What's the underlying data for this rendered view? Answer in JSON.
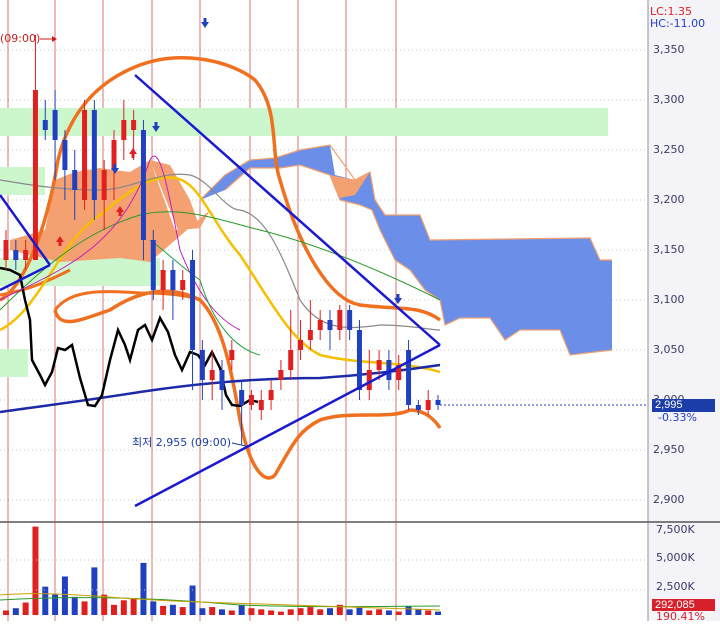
{
  "chart_data": [
    {
      "type": "candlestick",
      "title": "",
      "price_axis": {
        "ticks": [
          "3,350",
          "3,300",
          "3,250",
          "3,200",
          "3,150",
          "3,100",
          "3,050",
          "3,000",
          "2,950",
          "2,900"
        ],
        "ylim": [
          2880,
          3380
        ]
      },
      "header": {
        "lc": "LC:1.35",
        "hc": "HC:-11.00"
      },
      "current": {
        "price": "2,995",
        "change_pct": "-0.33%"
      },
      "annotations": {
        "low_label": "최저 2,955 (09:00)",
        "top_time": "(09:00)"
      },
      "candles": [
        {
          "o": 3140,
          "c": 3160,
          "h": 3170,
          "l": 3130,
          "up": true
        },
        {
          "o": 3150,
          "c": 3140,
          "h": 3160,
          "l": 3130,
          "up": false
        },
        {
          "o": 3140,
          "c": 3150,
          "h": 3160,
          "l": 3130,
          "up": true
        },
        {
          "o": 3140,
          "c": 3310,
          "h": 3365,
          "l": 3140,
          "up": true
        },
        {
          "o": 3270,
          "c": 3280,
          "h": 3300,
          "l": 3260,
          "up": false
        },
        {
          "o": 3290,
          "c": 3260,
          "h": 3310,
          "l": 3220,
          "up": false
        },
        {
          "o": 3260,
          "c": 3230,
          "h": 3270,
          "l": 3200,
          "up": false
        },
        {
          "o": 3230,
          "c": 3210,
          "h": 3250,
          "l": 3180,
          "up": false
        },
        {
          "o": 3200,
          "c": 3290,
          "h": 3300,
          "l": 3190,
          "up": true
        },
        {
          "o": 3290,
          "c": 3200,
          "h": 3300,
          "l": 3180,
          "up": false
        },
        {
          "o": 3200,
          "c": 3230,
          "h": 3240,
          "l": 3170,
          "up": true
        },
        {
          "o": 3230,
          "c": 3260,
          "h": 3270,
          "l": 3200,
          "up": true
        },
        {
          "o": 3260,
          "c": 3280,
          "h": 3300,
          "l": 3240,
          "up": true
        },
        {
          "o": 3280,
          "c": 3270,
          "h": 3290,
          "l": 3240,
          "up": true
        },
        {
          "o": 3270,
          "c": 3160,
          "h": 3280,
          "l": 3140,
          "up": false
        },
        {
          "o": 3160,
          "c": 3110,
          "h": 3170,
          "l": 3100,
          "up": false
        },
        {
          "o": 3110,
          "c": 3130,
          "h": 3140,
          "l": 3090,
          "up": true
        },
        {
          "o": 3130,
          "c": 3110,
          "h": 3140,
          "l": 3080,
          "up": false
        },
        {
          "o": 3110,
          "c": 3120,
          "h": 3130,
          "l": 3100,
          "up": true
        },
        {
          "o": 3140,
          "c": 3050,
          "h": 3150,
          "l": 3010,
          "up": false
        },
        {
          "o": 3050,
          "c": 3020,
          "h": 3060,
          "l": 3000,
          "up": false
        },
        {
          "o": 3020,
          "c": 3030,
          "h": 3050,
          "l": 3000,
          "up": true
        },
        {
          "o": 3030,
          "c": 3010,
          "h": 3040,
          "l": 2990,
          "up": false
        },
        {
          "o": 3040,
          "c": 3050,
          "h": 3060,
          "l": 3030,
          "up": true
        },
        {
          "o": 3010,
          "c": 2995,
          "h": 3020,
          "l": 2955,
          "up": false
        },
        {
          "o": 2995,
          "c": 3005,
          "h": 3010,
          "l": 2990,
          "up": true
        },
        {
          "o": 2990,
          "c": 3000,
          "h": 3010,
          "l": 2980,
          "up": true
        },
        {
          "o": 3000,
          "c": 3010,
          "h": 3020,
          "l": 2990,
          "up": true
        },
        {
          "o": 3020,
          "c": 3030,
          "h": 3040,
          "l": 3010,
          "up": true
        },
        {
          "o": 3030,
          "c": 3050,
          "h": 3090,
          "l": 3020,
          "up": true
        },
        {
          "o": 3050,
          "c": 3060,
          "h": 3080,
          "l": 3040,
          "up": true
        },
        {
          "o": 3060,
          "c": 3070,
          "h": 3100,
          "l": 3050,
          "up": true
        },
        {
          "o": 3070,
          "c": 3080,
          "h": 3090,
          "l": 3060,
          "up": true
        },
        {
          "o": 3080,
          "c": 3070,
          "h": 3090,
          "l": 3050,
          "up": false
        },
        {
          "o": 3070,
          "c": 3090,
          "h": 3095,
          "l": 3060,
          "up": true
        },
        {
          "o": 3090,
          "c": 3070,
          "h": 3095,
          "l": 3060,
          "up": false
        },
        {
          "o": 3070,
          "c": 3010,
          "h": 3080,
          "l": 3000,
          "up": false
        },
        {
          "o": 3010,
          "c": 3030,
          "h": 3050,
          "l": 3000,
          "up": true
        },
        {
          "o": 3030,
          "c": 3040,
          "h": 3050,
          "l": 3020,
          "up": true
        },
        {
          "o": 3040,
          "c": 3020,
          "h": 3050,
          "l": 3010,
          "up": false
        },
        {
          "o": 3020,
          "c": 3035,
          "h": 3045,
          "l": 3010,
          "up": true
        },
        {
          "o": 3050,
          "c": 2995,
          "h": 3060,
          "l": 2990,
          "up": false
        },
        {
          "o": 2995,
          "c": 2990,
          "h": 3000,
          "l": 2985,
          "up": false
        },
        {
          "o": 2990,
          "c": 3000,
          "h": 3010,
          "l": 2985,
          "up": true
        },
        {
          "o": 3000,
          "c": 2995,
          "h": 3005,
          "l": 2990,
          "up": false
        }
      ]
    },
    {
      "type": "bar",
      "title": "volume",
      "y_ticks": [
        "7,500K",
        "5,000K",
        "2,500K"
      ],
      "ylim": [
        0,
        8000
      ],
      "current": {
        "value": "292,085",
        "pct": "190.41%"
      },
      "values": [
        400,
        600,
        1100,
        7800,
        2500,
        1800,
        3400,
        1600,
        1200,
        4200,
        1800,
        900,
        1300,
        1500,
        4600,
        1200,
        800,
        900,
        700,
        2600,
        600,
        700,
        500,
        400,
        900,
        600,
        500,
        400,
        300,
        500,
        600,
        700,
        500,
        600,
        900,
        500,
        700,
        400,
        500,
        400,
        300,
        800,
        500,
        400,
        300
      ],
      "up": [
        true,
        false,
        true,
        true,
        false,
        false,
        false,
        false,
        true,
        false,
        true,
        true,
        true,
        true,
        false,
        false,
        true,
        false,
        true,
        false,
        false,
        true,
        false,
        true,
        false,
        true,
        true,
        true,
        true,
        true,
        true,
        true,
        true,
        false,
        true,
        false,
        false,
        true,
        true,
        false,
        true,
        false,
        false,
        true,
        false
      ]
    }
  ]
}
